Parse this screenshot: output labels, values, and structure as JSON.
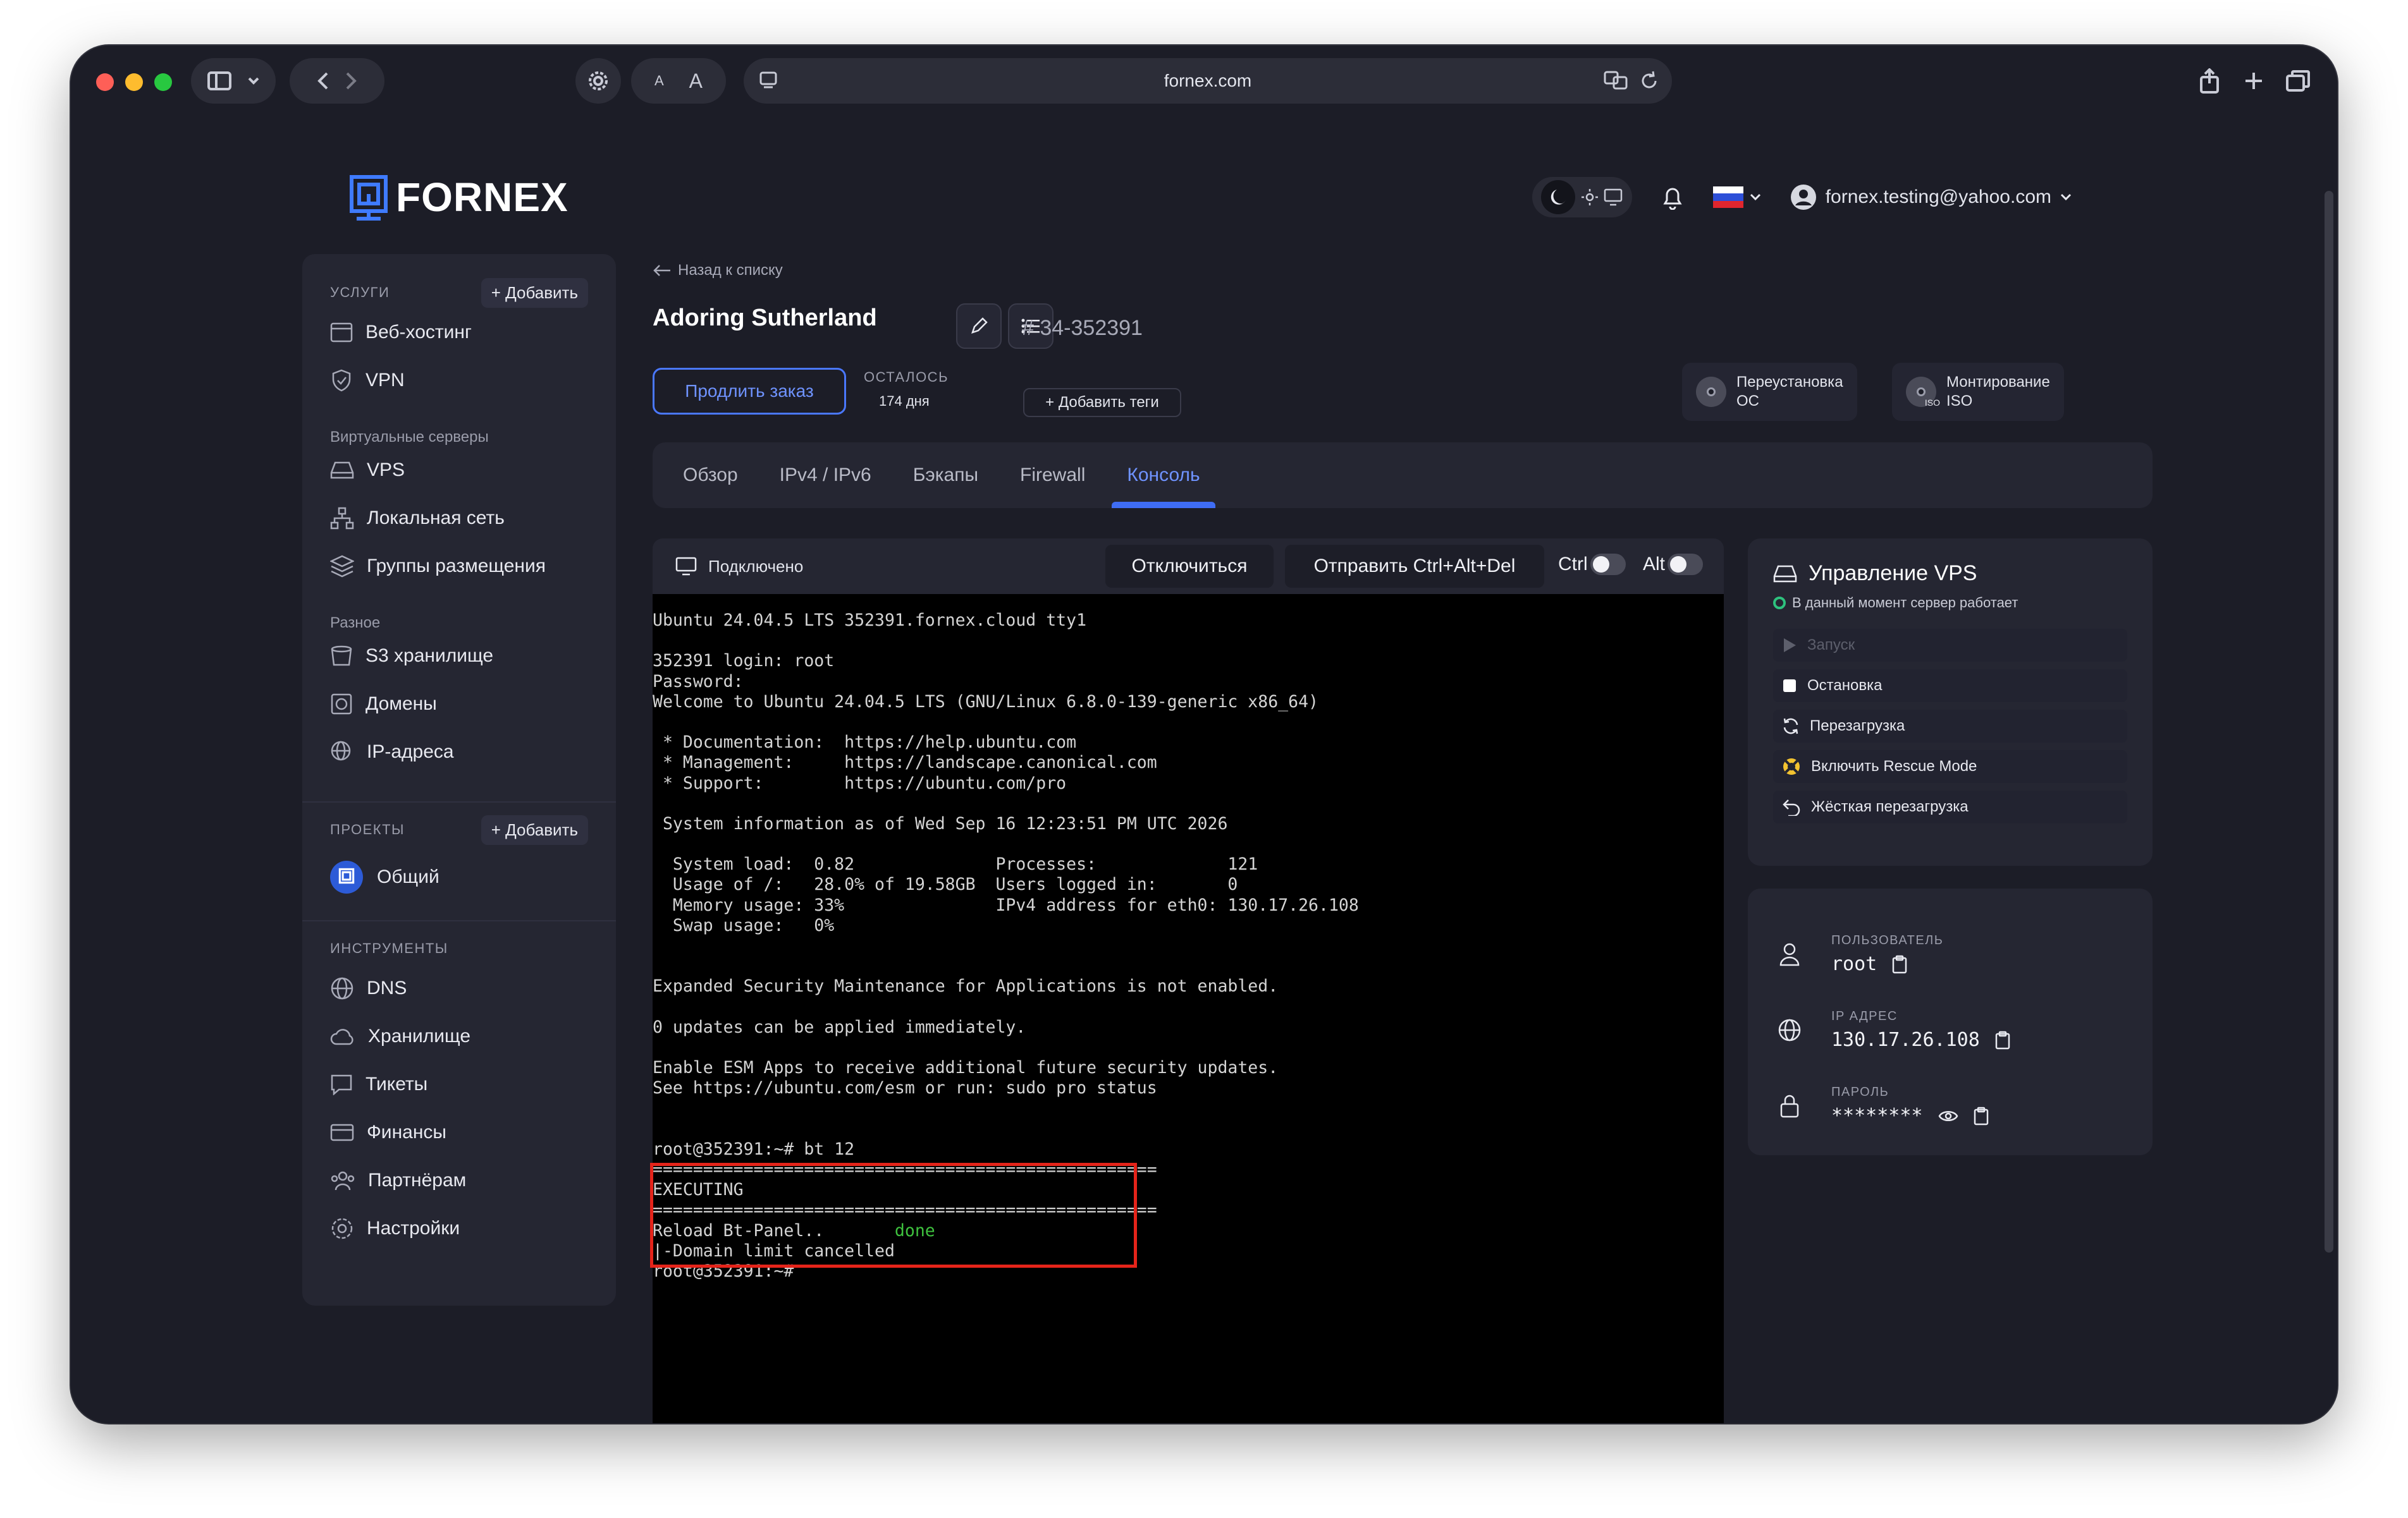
{
  "browser": {
    "url": "fornex.com",
    "font_small": "A",
    "font_large": "A"
  },
  "header": {
    "logo_text": "FORNEX",
    "user_email": "fornex.testing@yahoo.com"
  },
  "sidebar": {
    "services_title": "УСЛУГИ",
    "add_label": "+ Добавить",
    "services": [
      "Веб-хостинг",
      "VPN"
    ],
    "virtual_label": "Виртуальные серверы",
    "virtual": [
      "VPS",
      "Локальная сеть",
      "Группы размещения"
    ],
    "misc_label": "Разное",
    "misc": [
      "S3 хранилище",
      "Домены",
      "IP-адреса"
    ],
    "projects_title": "ПРОЕКТЫ",
    "project": "Общий",
    "tools_title": "ИНСТРУМЕНТЫ",
    "tools": [
      "DNS",
      "Хранилище",
      "Тикеты",
      "Финансы",
      "Партнёрам",
      "Настройки"
    ]
  },
  "main": {
    "back_link": "Назад к списку",
    "vm_name": "Adoring Sutherland",
    "vm_id": "# 34-352391",
    "renew_label": "Продлить заказ",
    "remain_label": "ОСТАЛОСЬ",
    "remain_value": "174 дня",
    "add_tags": "+ Добавить теги",
    "reinstall_os": [
      "Переустановка",
      "ОС"
    ],
    "mount_iso": [
      "Монтирование",
      "ISO"
    ],
    "iso_badge": "ISO",
    "tabs": [
      "Обзор",
      "IPv4 / IPv6",
      "Бэкапы",
      "Firewall",
      "Консоль"
    ],
    "active_tab": "Консоль"
  },
  "console": {
    "status": "Подключено",
    "disconnect": "Отключиться",
    "send_cad": "Отправить Ctrl+Alt+Del",
    "ctrl": "Ctrl",
    "alt": "Alt",
    "lines": [
      "Ubuntu 24.04.5 LTS 352391.fornex.cloud tty1",
      "",
      "352391 login: root",
      "Password:",
      "Welcome to Ubuntu 24.04.5 LTS (GNU/Linux 6.8.0-139-generic x86_64)",
      "",
      " * Documentation:  https://help.ubuntu.com",
      " * Management:     https://landscape.canonical.com",
      " * Support:        https://ubuntu.com/pro",
      "",
      " System information as of Wed Sep 16 12:23:51 PM UTC 2026",
      "",
      "  System load:  0.82              Processes:             121",
      "  Usage of /:   28.0% of 19.58GB  Users logged in:       0",
      "  Memory usage: 33%               IPv4 address for eth0: 130.17.26.108",
      "  Swap usage:   0%",
      "",
      "",
      "Expanded Security Maintenance for Applications is not enabled.",
      "",
      "0 updates can be applied immediately.",
      "",
      "Enable ESM Apps to receive additional future security updates.",
      "See https://ubuntu.com/esm or run: sudo pro status",
      "",
      "",
      "root@352391:~# bt 12",
      "==================================================",
      "EXECUTING",
      "==================================================",
      "Reload Bt-Panel..       ",
      "|-Domain limit cancelled",
      "root@352391:~#"
    ],
    "done_text": "done"
  },
  "vps_control": {
    "title": "Управление VPS",
    "status": "В данный момент сервер работает",
    "actions": [
      "Запуск",
      "Остановка",
      "Перезагрузка",
      "Включить Rescue Mode",
      "Жёсткая перезагрузка"
    ]
  },
  "credentials": {
    "user_label": "ПОЛЬЗОВАТЕЛЬ",
    "user_value": "root",
    "ip_label": "IP АДРЕС",
    "ip_value": "130.17.26.108",
    "pass_label": "ПАРОЛЬ",
    "pass_value": "********"
  },
  "colors": {
    "accent": "#3f6df5",
    "success": "#2ec27e",
    "highlight": "#e5241a"
  }
}
